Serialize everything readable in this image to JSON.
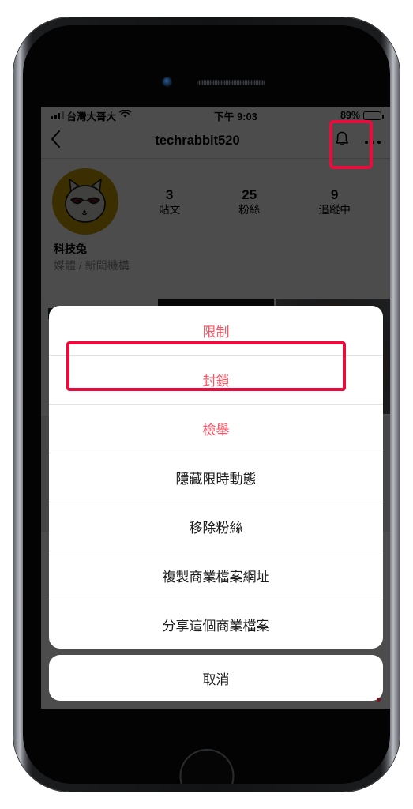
{
  "device": {
    "type": "iphone-with-home-button"
  },
  "status_bar": {
    "carrier": "台灣大哥大",
    "time": "下午 9:03",
    "battery_percent": "89%",
    "battery_level": 89,
    "icons": [
      "signal-bars-icon",
      "wifi-icon",
      "battery-icon"
    ]
  },
  "nav_bar": {
    "back_icon": "chevron-left-icon",
    "title": "techrabbit520",
    "notifications_icon": "bell-icon",
    "more_icon": "more-options-icon",
    "more_label": "•••"
  },
  "profile": {
    "avatar_alt": "cat-with-sunglasses-avatar",
    "avatar_bg": "#c79a06",
    "stats": [
      {
        "value": "3",
        "label": "貼文"
      },
      {
        "value": "25",
        "label": "粉絲"
      },
      {
        "value": "9",
        "label": "追蹤中"
      }
    ],
    "display_name": "科技兔",
    "category": "媒體 / 新聞機構"
  },
  "action_sheet": {
    "items": [
      {
        "label": "限制",
        "style": "danger"
      },
      {
        "label": "封鎖",
        "style": "danger"
      },
      {
        "label": "檢舉",
        "style": "danger"
      },
      {
        "label": "隱藏限時動態",
        "style": "default"
      },
      {
        "label": "移除粉絲",
        "style": "default"
      },
      {
        "label": "複製商業檔案網址",
        "style": "default"
      },
      {
        "label": "分享這個商業檔案",
        "style": "default"
      }
    ],
    "cancel_label": "取消"
  },
  "annotations": {
    "color": "#ec0b3d",
    "boxes": [
      {
        "name": "more-options-highlight",
        "target": "more-options-icon"
      },
      {
        "name": "block-item-highlight",
        "target": "封鎖"
      }
    ]
  },
  "colors": {
    "danger_text": "#fa5464",
    "annotation_red": "#ec0b3d",
    "sheet_bg": "#ffffff",
    "dim_overlay": "rgba(0,0,0,0.70)"
  }
}
